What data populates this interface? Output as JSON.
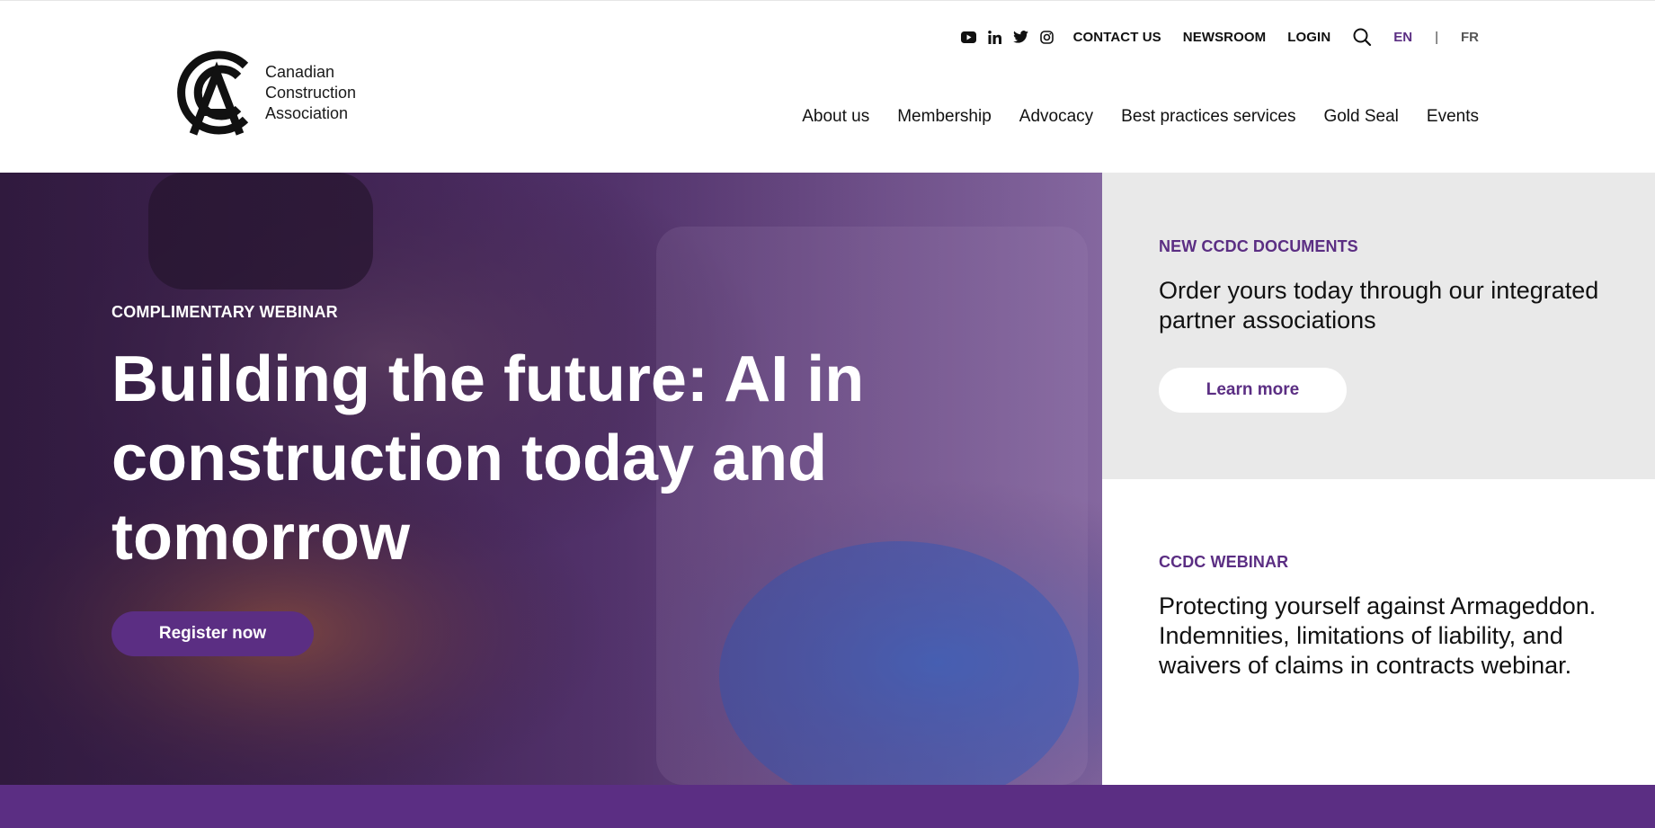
{
  "brand": {
    "name_lines": [
      "Canadian",
      "Construction",
      "Association"
    ]
  },
  "utility": {
    "social": [
      "youtube-icon",
      "linkedin-icon",
      "twitter-icon",
      "instagram-icon"
    ],
    "contact": "CONTACT US",
    "newsroom": "NEWSROOM",
    "login": "LOGIN",
    "lang_en": "EN",
    "lang_sep": "|",
    "lang_fr": "FR"
  },
  "nav": {
    "items": [
      "About us",
      "Membership",
      "Advocacy",
      "Best practices services",
      "Gold Seal",
      "Events"
    ]
  },
  "hero": {
    "eyebrow": "COMPLIMENTARY WEBINAR",
    "title_lines": [
      "Building the future: AI in",
      "construction today and",
      "tomorrow"
    ],
    "button": "Register now"
  },
  "panels": [
    {
      "eyebrow": "NEW CCDC DOCUMENTS",
      "text": "Order yours today through our integrated partner associations",
      "button": "Learn more"
    },
    {
      "eyebrow": "CCDC WEBINAR",
      "text": "Protecting yourself against Armageddon. Indemnities, limitations of liability, and waivers of claims in contracts webinar."
    }
  ],
  "colors": {
    "brand_purple": "#5b2e83",
    "panel_gray": "#e9e9e9"
  }
}
